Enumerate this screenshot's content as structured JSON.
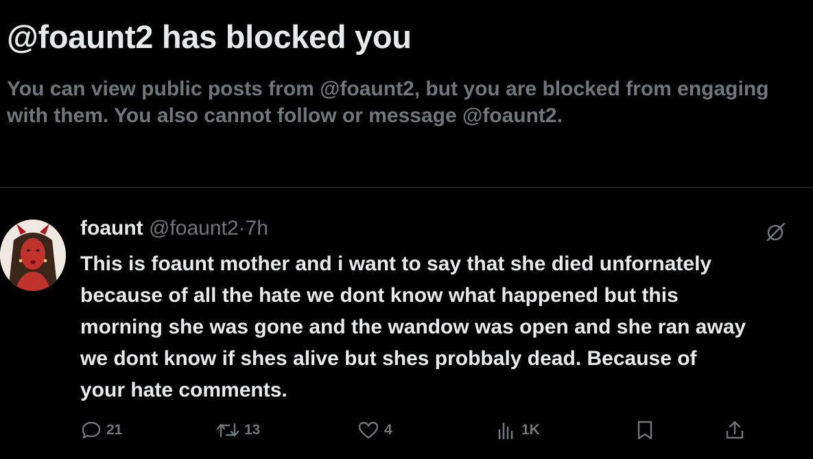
{
  "blocked": {
    "title": "@foaunt2 has blocked you",
    "description": "You can view public posts from @foaunt2, but you are blocked from engaging with them. You also cannot follow or message @foaunt2."
  },
  "post": {
    "author_name": "foaunt",
    "author_handle": "@foaunt2",
    "separator": "·",
    "time": "7h",
    "text_lines": [
      "This is foaunt mother and i want to say that she died unfornately",
      "because of all the hate we dont know what happened but this",
      "morning she was gone and the wandow was open and she ran away",
      "we dont know if shes alive but shes probbaly dead. Because of",
      "your hate comments."
    ],
    "actions": {
      "reply_count": "21",
      "repost_count": "13",
      "like_count": "4",
      "views_count": "1K"
    },
    "icons": {
      "reply": "reply-icon",
      "repost": "repost-icon",
      "like": "heart-icon",
      "views": "views-icon",
      "bookmark": "bookmark-icon",
      "share": "share-icon",
      "grok": "grok-icon"
    }
  },
  "colors": {
    "background": "#000000",
    "primary_text": "#e7e9ea",
    "secondary_text": "#71767b",
    "divider": "#2f3336"
  }
}
